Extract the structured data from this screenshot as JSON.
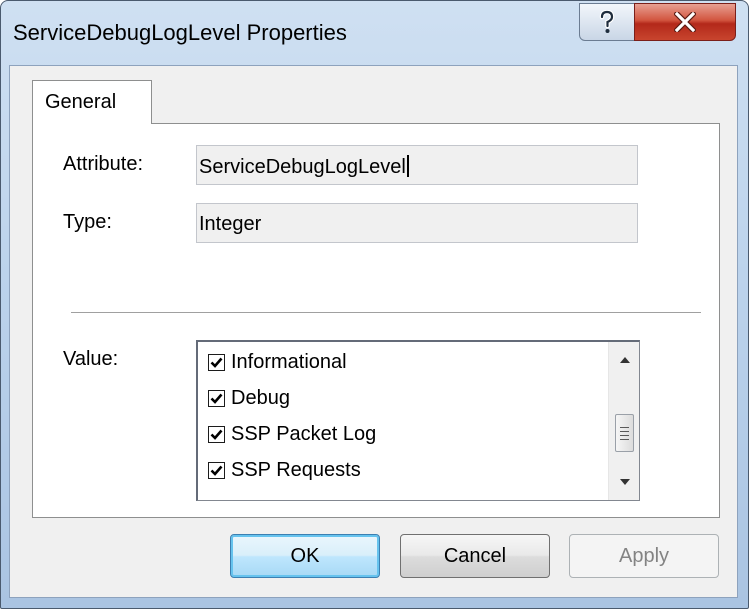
{
  "window": {
    "title": "ServiceDebugLogLevel Properties",
    "help_glyph": "?",
    "close_glyph": "X"
  },
  "tabs": [
    {
      "label": "General"
    }
  ],
  "fields": {
    "attribute": {
      "label": "Attribute:",
      "value": "ServiceDebugLogLevel"
    },
    "type": {
      "label": "Type:",
      "value": "Integer"
    },
    "value": {
      "label": "Value:"
    }
  },
  "value_list": {
    "items": [
      {
        "label": "Informational",
        "checked": true
      },
      {
        "label": "Debug",
        "checked": true
      },
      {
        "label": "SSP Packet Log",
        "checked": true
      },
      {
        "label": "SSP Requests",
        "checked": true
      }
    ]
  },
  "buttons": {
    "ok": "OK",
    "cancel": "Cancel",
    "apply": "Apply"
  },
  "icons": {
    "help": "question-mark-icon",
    "close": "close-x-icon",
    "checkbox": "checkmark-icon",
    "scroll_up": "triangle-up-icon",
    "scroll_down": "triangle-down-icon"
  },
  "colors": {
    "close_button": "#c8452e",
    "default_button": "#a7d9f5",
    "frame": "#bcd3ec"
  }
}
